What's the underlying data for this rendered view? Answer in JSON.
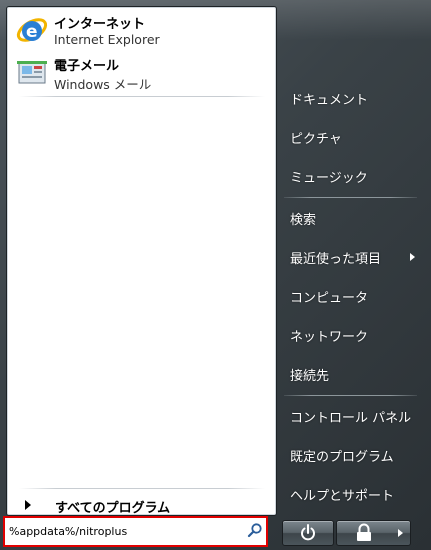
{
  "pinned": [
    {
      "title": "インターネット",
      "subtitle": "Internet Explorer",
      "icon": "internet-explorer-icon"
    },
    {
      "title": "電子メール",
      "subtitle": "Windows メール",
      "icon": "windows-mail-icon"
    }
  ],
  "all_programs_label": "すべてのプログラム",
  "search": {
    "value": "%appdata%/nitroplus",
    "highlight_color": "#e00000"
  },
  "right_items": [
    {
      "label": "ドキュメント"
    },
    {
      "label": "ピクチャ"
    },
    {
      "label": "ミュージック"
    },
    {
      "label": "検索"
    },
    {
      "label": "最近使った項目",
      "has_submenu": true
    },
    {
      "label": "コンピュータ"
    },
    {
      "label": "ネットワーク"
    },
    {
      "label": "接続先"
    },
    {
      "label": "コントロール パネル"
    },
    {
      "label": "既定のプログラム"
    },
    {
      "label": "ヘルプとサポート"
    }
  ],
  "power_buttons": [
    "power-icon",
    "lock-icon",
    "arrow-right-icon"
  ]
}
